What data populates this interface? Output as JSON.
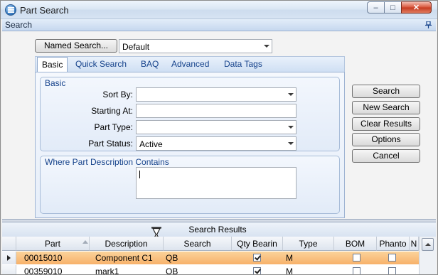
{
  "window": {
    "title": "Part Search",
    "minimize_glyph": "‒",
    "maximize_glyph": "□",
    "close_glyph": "✕"
  },
  "search_panel": {
    "header": "Search",
    "named_search_label": "Named Search...",
    "named_search_value": "Default",
    "tabs": [
      {
        "label": "Basic",
        "active": true
      },
      {
        "label": "Quick Search",
        "active": false
      },
      {
        "label": "BAQ",
        "active": false
      },
      {
        "label": "Advanced",
        "active": false
      },
      {
        "label": "Data Tags",
        "active": false
      }
    ],
    "basic_group": {
      "title": "Basic",
      "sort_by_label": "Sort By:",
      "sort_by_value": "",
      "starting_at_label": "Starting At:",
      "starting_at_value": "",
      "part_type_label": "Part Type:",
      "part_type_value": "",
      "part_status_label": "Part Status:",
      "part_status_value": "Active"
    },
    "description_group": {
      "title": "Where Part Description Contains",
      "value": ""
    },
    "buttons": {
      "search": "Search",
      "new_search": "New Search",
      "clear_results": "Clear Results",
      "options": "Options",
      "cancel": "Cancel"
    }
  },
  "results": {
    "title": "Search Results",
    "columns": [
      "Part",
      "Description",
      "Search",
      "Qty Bearin",
      "Type",
      "BOM",
      "Phanto",
      "N"
    ],
    "rows": [
      {
        "part": "00015010",
        "description": "Component C1",
        "search": "QB",
        "qty_bearing": true,
        "type": "M",
        "bom": false,
        "phantom": false,
        "selected": true
      },
      {
        "part": "00359010",
        "description": "mark1",
        "search": "QB",
        "qty_bearing": true,
        "type": "M",
        "bom": false,
        "phantom": false,
        "selected": false
      }
    ]
  },
  "colors": {
    "selected_row": "#f7b16a",
    "tab_text": "#15428b",
    "close_button": "#c43a20"
  }
}
